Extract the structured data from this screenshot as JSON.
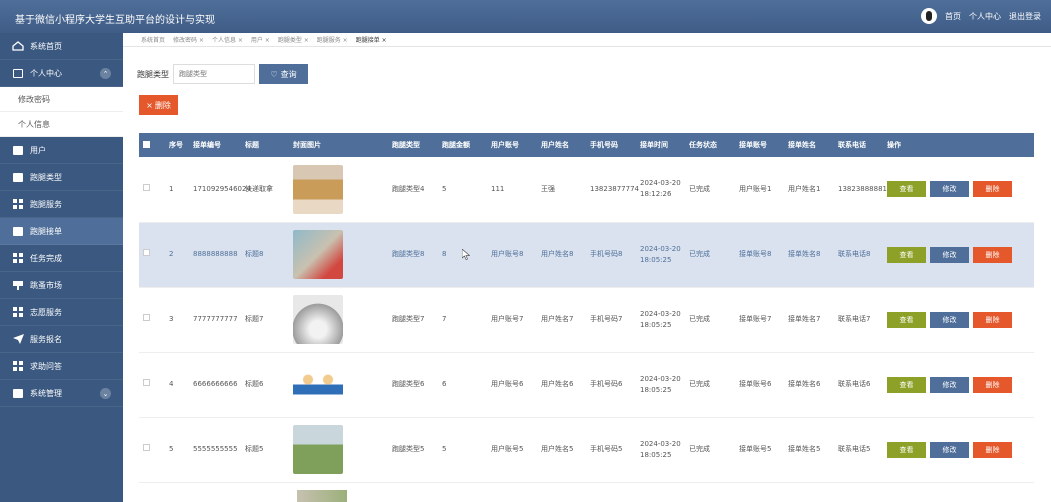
{
  "header": {
    "title": "基于微信小程序大学生互助平台的设计与实现",
    "links": [
      "首页",
      "个人中心",
      "退出登录"
    ]
  },
  "sidebar": {
    "items": [
      {
        "label": "系统首页",
        "icon": "home-icon"
      },
      {
        "label": "个人中心",
        "icon": "window-icon",
        "expanded": true,
        "sub": [
          "修改密码",
          "个人信息"
        ]
      },
      {
        "label": "用户",
        "icon": "clipboard-icon"
      },
      {
        "label": "跑腿类型",
        "icon": "chat-icon"
      },
      {
        "label": "跑腿服务",
        "icon": "grid-icon"
      },
      {
        "label": "跑腿接单",
        "icon": "wallet-icon",
        "active": true
      },
      {
        "label": "任务完成",
        "icon": "grid-icon"
      },
      {
        "label": "跳蚤市场",
        "icon": "sign-icon"
      },
      {
        "label": "志愿服务",
        "icon": "grid-icon"
      },
      {
        "label": "服务报名",
        "icon": "send-icon"
      },
      {
        "label": "求助问答",
        "icon": "grid-icon"
      },
      {
        "label": "系统管理",
        "icon": "ticket-icon",
        "expandable": true
      }
    ]
  },
  "tags": [
    "系统首页",
    "修改密码 ×",
    "个人信息 ×",
    "用户 ×",
    "跑腿类型 ×",
    "跑腿服务 ×",
    "跑腿接单 ×"
  ],
  "search": {
    "label": "跑腿类型",
    "placeholder": "跑腿类型",
    "button": "查询"
  },
  "delete_button": "删除",
  "table": {
    "columns": [
      "序号",
      "接单编号",
      "标题",
      "封面图片",
      "跑腿类型",
      "跑腿金额",
      "用户账号",
      "用户姓名",
      "手机号码",
      "接单时间",
      "任务状态",
      "接单账号",
      "接单姓名",
      "联系电话",
      "操作"
    ],
    "rows": [
      [
        "1",
        "1710929546024",
        "快递取拿",
        "",
        "跑腿类型4",
        "5",
        "111",
        "王强",
        "13823877774",
        "2024-03-20 18:12:26",
        "已完成",
        "用户账号1",
        "用户姓名1",
        "13823888881"
      ],
      [
        "2",
        "8888888888",
        "标题8",
        "",
        "跑腿类型8",
        "8",
        "用户账号8",
        "用户姓名8",
        "手机号码8",
        "2024-03-20 18:05:25",
        "已完成",
        "接单账号8",
        "接单姓名8",
        "联系电话8"
      ],
      [
        "3",
        "7777777777",
        "标题7",
        "",
        "跑腿类型7",
        "7",
        "用户账号7",
        "用户姓名7",
        "手机号码7",
        "2024-03-20 18:05:25",
        "已完成",
        "接单账号7",
        "接单姓名7",
        "联系电话7"
      ],
      [
        "4",
        "6666666666",
        "标题6",
        "",
        "跑腿类型6",
        "6",
        "用户账号6",
        "用户姓名6",
        "手机号码6",
        "2024-03-20 18:05:25",
        "已完成",
        "接单账号6",
        "接单姓名6",
        "联系电话6"
      ],
      [
        "5",
        "5555555555",
        "标题5",
        "",
        "跑腿类型5",
        "5",
        "用户账号5",
        "用户姓名5",
        "手机号码5",
        "2024-03-20 18:05:25",
        "已完成",
        "接单账号5",
        "接单姓名5",
        "联系电话5"
      ]
    ],
    "actions": [
      "查看",
      "修改",
      "删除"
    ]
  },
  "colors": {
    "primary": "#4f6f9a",
    "sidebar": "#3a5880",
    "danger": "#e5582b",
    "view": "#8da128"
  }
}
